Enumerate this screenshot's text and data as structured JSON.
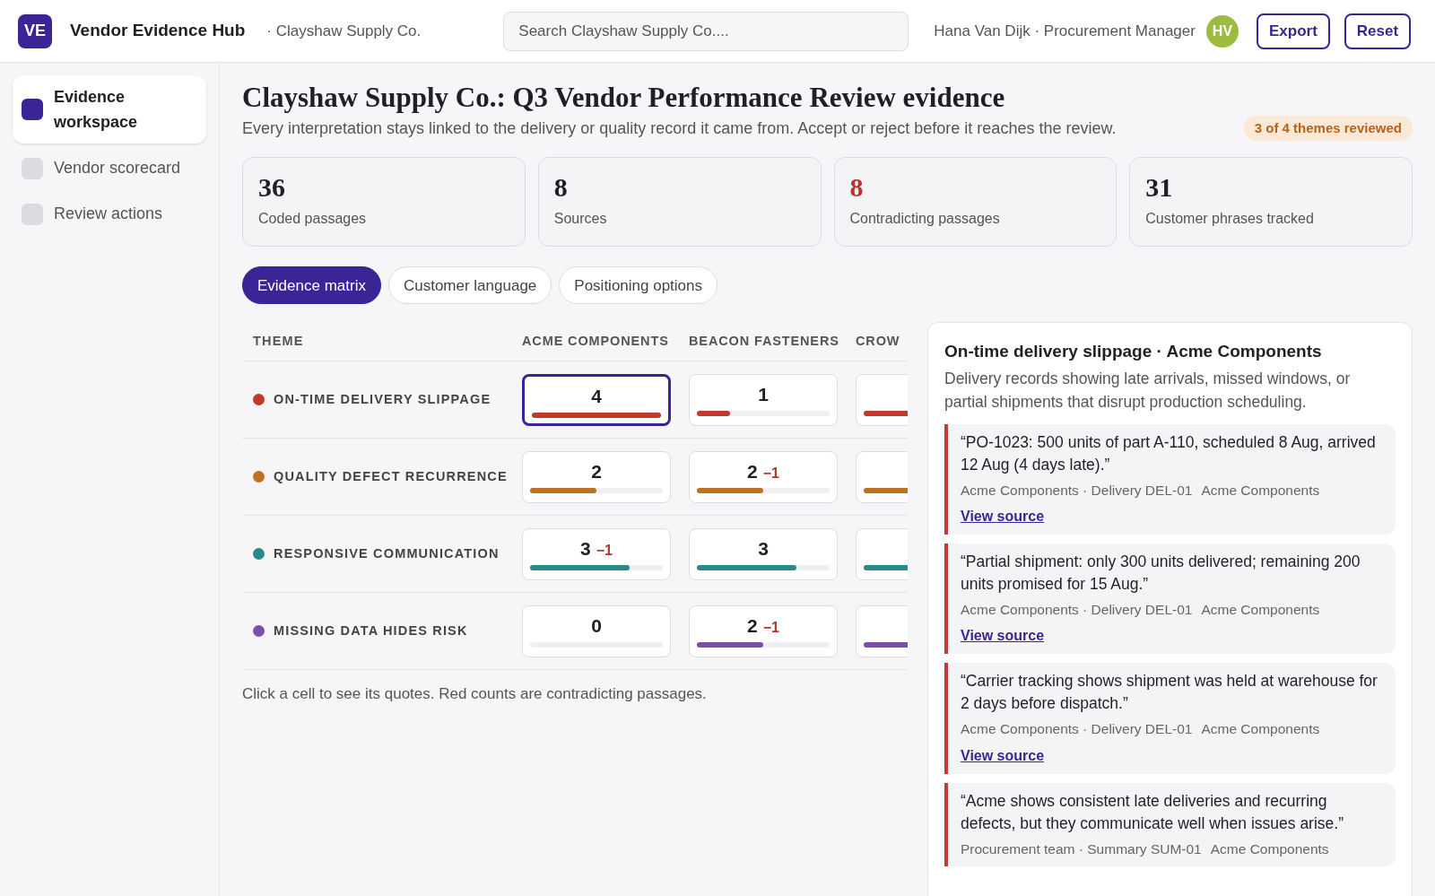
{
  "app": {
    "logo": "VE",
    "name": "Vendor Evidence Hub",
    "context": "· Clayshaw Supply Co."
  },
  "search": {
    "placeholder": "Search Clayshaw Supply Co...."
  },
  "user": {
    "label": "Hana Van Dijk · Procurement Manager",
    "initials": "HV"
  },
  "header_buttons": [
    "Export",
    "Reset"
  ],
  "sidebar": {
    "items": [
      {
        "label": "Evidence workspace",
        "selected": true
      },
      {
        "label": "Vendor scorecard",
        "selected": false
      },
      {
        "label": "Review actions",
        "selected": false
      }
    ]
  },
  "page": {
    "title": "Clayshaw Supply Co.: Q3 Vendor Performance Review evidence",
    "subtitle": "Every interpretation stays linked to the delivery or quality record it came from. Accept or reject before it reaches the review.",
    "badge": "3 of 4 themes reviewed"
  },
  "stats": [
    {
      "value": "36",
      "label": "Coded passages",
      "alert": false
    },
    {
      "value": "8",
      "label": "Sources",
      "alert": false
    },
    {
      "value": "8",
      "label": "Contradicting passages",
      "alert": true
    },
    {
      "value": "31",
      "label": "Customer phrases tracked",
      "alert": false
    }
  ],
  "tabs": [
    {
      "label": "Evidence matrix",
      "selected": true
    },
    {
      "label": "Customer language",
      "selected": false
    },
    {
      "label": "Positioning options",
      "selected": false
    }
  ],
  "matrix": {
    "theme_header": "THEME",
    "columns": [
      "ACME COMPONENTS",
      "BEACON FASTENERS",
      "CROW"
    ],
    "rows": [
      {
        "theme": "ON-TIME DELIVERY SLIPPAGE",
        "color": "#c0392b",
        "cells": [
          {
            "count": "4",
            "level": 1.0,
            "selected": true
          },
          {
            "count": "1",
            "level": 0.25,
            "selected": false
          },
          {
            "level": 0.5,
            "selected": false
          }
        ]
      },
      {
        "theme": "QUALITY DEFECT RECURRENCE",
        "color": "#c0701e",
        "cells": [
          {
            "count": "2",
            "level": 0.5,
            "selected": false
          },
          {
            "count": "2",
            "delta": "−1",
            "level": 0.5,
            "selected": false
          },
          {
            "level": 0.5,
            "selected": false
          }
        ]
      },
      {
        "theme": "RESPONSIVE COMMUNICATION",
        "color": "#2a8a8a",
        "cells": [
          {
            "count": "3",
            "delta": "−1",
            "level": 0.75,
            "selected": false
          },
          {
            "count": "3",
            "level": 0.75,
            "selected": false
          },
          {
            "level": 0.5,
            "selected": false
          }
        ]
      },
      {
        "theme": "MISSING DATA HIDES RISK",
        "color": "#7b4fa8",
        "cells": [
          {
            "count": "0",
            "level": 0,
            "selected": false
          },
          {
            "count": "2",
            "delta": "−1",
            "level": 0.5,
            "selected": false
          },
          {
            "level": 0.5,
            "selected": false
          }
        ]
      }
    ],
    "footnote": "Click a cell to see its quotes. Red counts are contradicting passages."
  },
  "detail": {
    "title": "On-time delivery slippage · Acme Components",
    "description": "Delivery records showing late arrivals, missed windows, or partial shipments that disrupt production scheduling.",
    "quotes": [
      {
        "text": "“PO-1023: 500 units of part A-110, scheduled 8 Aug, arrived 12 Aug (4 days late).”",
        "source": "Acme Components · Delivery DEL-01",
        "vendor": "Acme Components",
        "link": "View source"
      },
      {
        "text": "“Partial shipment: only 300 units delivered; remaining 200 units promised for 15 Aug.”",
        "source": "Acme Components · Delivery DEL-01",
        "vendor": "Acme Components",
        "link": "View source"
      },
      {
        "text": "“Carrier tracking shows shipment was held at warehouse for 2 days before dispatch.”",
        "source": "Acme Components · Delivery DEL-01",
        "vendor": "Acme Components",
        "link": "View source"
      },
      {
        "text": "“Acme shows consistent late deliveries and recurring defects, but they communicate well when issues arise.”",
        "source": "Procurement team · Summary SUM-01",
        "vendor": "Acme Components"
      }
    ]
  }
}
